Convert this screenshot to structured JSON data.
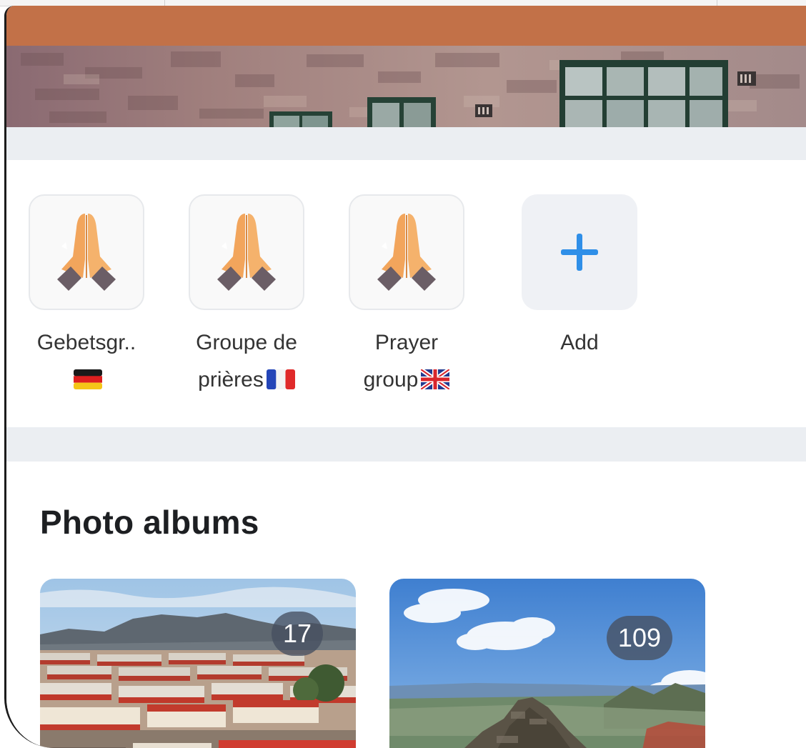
{
  "groups": {
    "items": [
      {
        "name": "Gebetsgr..",
        "line1": "Gebetsgr..",
        "line2": "",
        "flag": "germany-flag-icon",
        "icon": "folded-hands-icon"
      },
      {
        "name": "Groupe de prières",
        "line1": "Groupe de",
        "line2": "prières",
        "flag": "france-flag-icon",
        "icon": "folded-hands-icon"
      },
      {
        "name": "Prayer group",
        "line1": "Prayer",
        "line2": "group",
        "flag": "uk-flag-icon",
        "icon": "folded-hands-icon"
      }
    ],
    "add_label": "Add",
    "add_icon": "plus-icon"
  },
  "albums": {
    "title": "Photo albums",
    "items": [
      {
        "count": "17",
        "scene": "township-rooftops-with-mountain"
      },
      {
        "count": "109",
        "scene": "mountain-peak-with-sky-and-coast"
      }
    ]
  },
  "colors": {
    "status_bar": "#c27148",
    "section_gap": "#ebeef2",
    "add_plus": "#2f8fe8",
    "count_badge": "#4a5362"
  }
}
